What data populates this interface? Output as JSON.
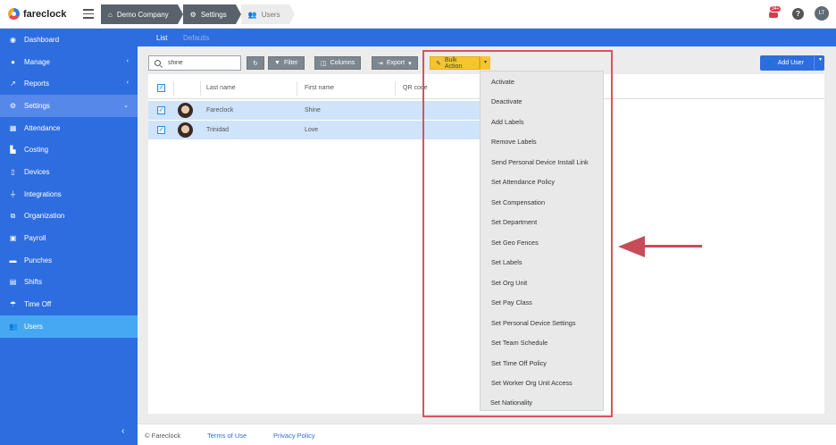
{
  "app": {
    "brand": "fareclock"
  },
  "breadcrumb": [
    "Demo Company",
    "Settings",
    "Users"
  ],
  "notifications": {
    "count": "34+"
  },
  "help_label": "?",
  "user_initials": "LT",
  "sidebar": {
    "items": [
      {
        "label": "Dashboard",
        "icon": "dashboard-icon"
      },
      {
        "label": "Manage",
        "icon": "person-icon",
        "chevron": "‹"
      },
      {
        "label": "Reports",
        "icon": "chart-icon",
        "chevron": "‹"
      },
      {
        "label": "Settings",
        "icon": "gear-icon",
        "chevron": "⌄"
      },
      {
        "label": "Attendance",
        "icon": "calendar-icon"
      },
      {
        "label": "Costing",
        "icon": "factory-icon"
      },
      {
        "label": "Devices",
        "icon": "tablet-icon"
      },
      {
        "label": "Integrations",
        "icon": "plug-icon"
      },
      {
        "label": "Organization",
        "icon": "org-chart-icon"
      },
      {
        "label": "Payroll",
        "icon": "money-icon"
      },
      {
        "label": "Punches",
        "icon": "car-icon"
      },
      {
        "label": "Shifts",
        "icon": "calendar-check-icon"
      },
      {
        "label": "Time Off",
        "icon": "beach-icon"
      },
      {
        "label": "Users",
        "icon": "users-icon"
      }
    ],
    "collapse_label": "‹"
  },
  "tabs": {
    "list": "List",
    "defaults": "Defaults"
  },
  "toolbar": {
    "search_value": "shine",
    "refresh_label": "↻",
    "filter_label": "Filter",
    "columns_label": "Columns",
    "export_label": "Export",
    "bulk_label": "Bulk Action",
    "add_user_label": "Add User"
  },
  "table": {
    "headers": {
      "last_name": "Last name",
      "first_name": "First name",
      "qr_code": "QR code"
    },
    "rows": [
      {
        "last_name": "Fareclock",
        "first_name": "Shine"
      },
      {
        "last_name": "Trinidad",
        "first_name": "Love"
      }
    ]
  },
  "bulk_menu": [
    "Activate",
    "Deactivate",
    "Add Labels",
    "Remove Labels",
    "Send Personal Device Install Link",
    "Set Attendance Policy",
    "Set Compensation",
    "Set Department",
    "Set Geo Fences",
    "Set Labels",
    "Set Org Unit",
    "Set Pay Class",
    "Set Personal Device Settings",
    "Set Team Schedule",
    "Set Time Off Policy",
    "Set Worker Org Unit Access",
    "Set Nationality"
  ],
  "footer": {
    "copyright": "© Fareclock",
    "terms": "Terms of Use",
    "privacy": "Privacy Policy"
  },
  "colors": {
    "primary": "#2d6de0",
    "bulk": "#f6c430",
    "highlight": "#d9535b",
    "selected_row": "#cfe3fa"
  }
}
